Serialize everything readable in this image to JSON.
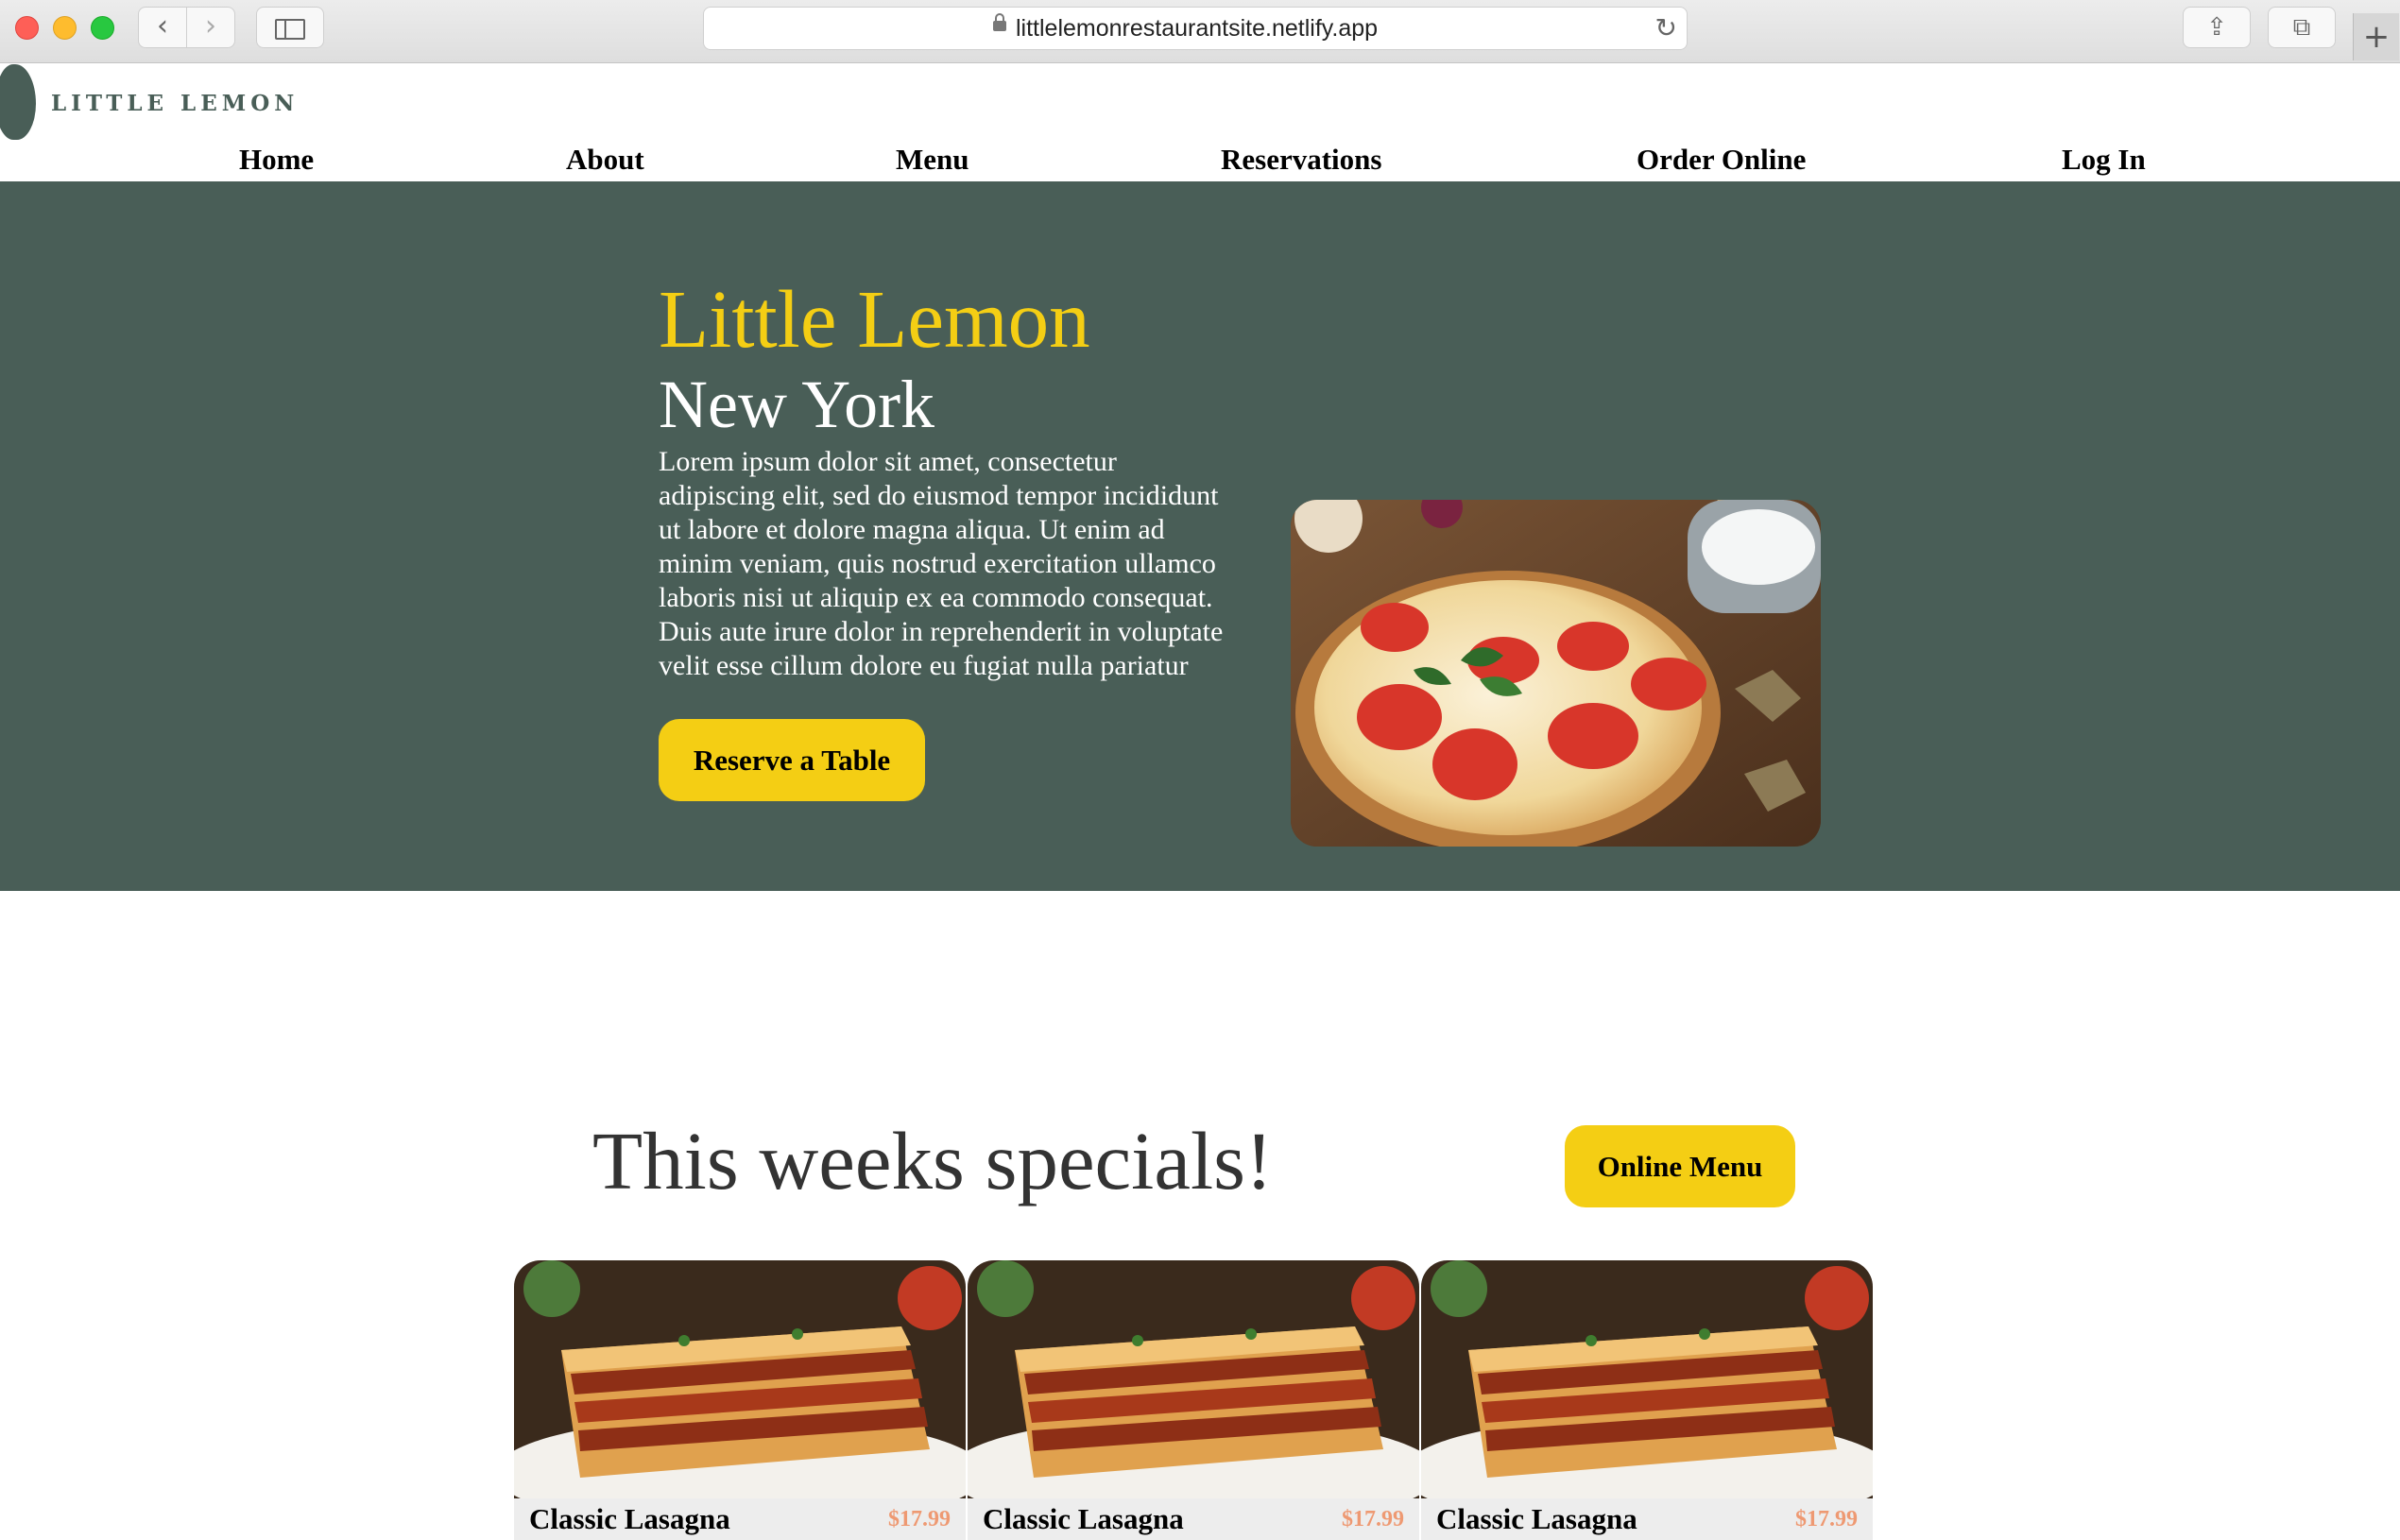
{
  "browser": {
    "url": "littlelemonrestaurantsite.netlify.app",
    "back_icon": "‹",
    "forward_icon": "›",
    "reload_icon": "↻",
    "share_icon": "⇪",
    "tabs_icon": "⧉",
    "new_tab_icon": "+"
  },
  "site": {
    "logo_text": "LITTLE LEMON",
    "nav": [
      "Home",
      "About",
      "Menu",
      "Reservations",
      "Order Online",
      "Log In"
    ]
  },
  "hero": {
    "title": "Little Lemon",
    "subtitle": "New York",
    "body": "Lorem ipsum dolor sit amet, consectetur adipiscing elit, sed do eiusmod tempor incididunt ut labore et dolore magna aliqua. Ut enim ad minim veniam, quis nostrud exercitation ullamco laboris nisi ut aliquip ex ea commodo consequat. Duis aute irure dolor in reprehenderit in voluptate velit esse cillum dolore eu fugiat nulla pariatur",
    "cta": "Reserve a Table"
  },
  "specials": {
    "title": "This weeks specials!",
    "menu_button": "Online Menu",
    "cards": [
      {
        "name": "Classic Lasagna",
        "price": "$17.99"
      },
      {
        "name": "Classic Lasagna",
        "price": "$17.99"
      },
      {
        "name": "Classic Lasagna",
        "price": "$17.99"
      }
    ]
  },
  "colors": {
    "primary_green": "#495e57",
    "primary_yellow": "#f4ce14",
    "price": "#ee9972"
  }
}
